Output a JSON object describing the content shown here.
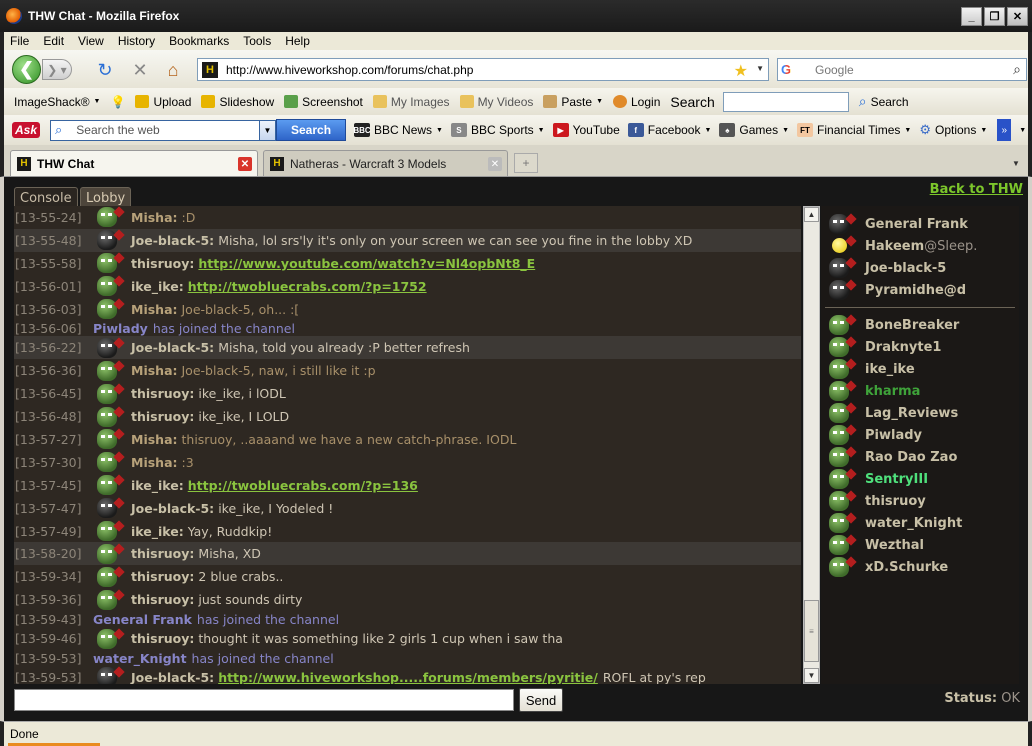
{
  "window": {
    "title": "THW Chat - Mozilla Firefox",
    "min": "_",
    "max": "❐",
    "close": "✕"
  },
  "menu": [
    "File",
    "Edit",
    "View",
    "History",
    "Bookmarks",
    "Tools",
    "Help"
  ],
  "nav": {
    "url": "http://www.hiveworkshop.com/forums/chat.php",
    "search_placeholder": "Google"
  },
  "imageshack": {
    "brand": "ImageShack®",
    "upload": "Upload",
    "slideshow": "Slideshow",
    "screenshot": "Screenshot",
    "my_images": "My Images",
    "my_videos": "My Videos",
    "paste": "Paste",
    "login": "Login",
    "search_label": "Search",
    "search_button": "Search"
  },
  "askbar": {
    "logo": "Ask",
    "placeholder": "Search the web",
    "button": "Search",
    "links": [
      "BBC News",
      "BBC Sports",
      "YouTube",
      "Facebook",
      "Games",
      "Financial Times",
      "Options"
    ]
  },
  "tabs": [
    {
      "label": "THW Chat",
      "active": true
    },
    {
      "label": "Natheras - Warcraft 3 Models",
      "active": false
    }
  ],
  "chat": {
    "back_link": "Back to THW",
    "channel_tabs": [
      "Console",
      "Lobby"
    ],
    "messages": [
      {
        "ts": "[13-55-24]",
        "user": "Misha:",
        "text": ":D",
        "misha": true
      },
      {
        "ts": "[13-55-48]",
        "user": "Joe-black-5:",
        "text": "Misha, lol srs'ly it's only on your screen we can see you fine in the lobby XD",
        "hl": true,
        "dark": true
      },
      {
        "ts": "[13-55-58]",
        "user": "thisruoy:",
        "link": "http://www.youtube.com/watch?v=Nl4opbNt8_E"
      },
      {
        "ts": "[13-56-01]",
        "user": "ike_ike:",
        "link": "http://twobluecrabs.com/?p=1752"
      },
      {
        "ts": "[13-56-03]",
        "user": "Misha:",
        "text": "Joe-black-5, oh... :[",
        "misha": true
      },
      {
        "ts": "[13-56-06]",
        "sys": "Piwlady",
        "systext": "has joined the channel"
      },
      {
        "ts": "[13-56-22]",
        "user": "Joe-black-5:",
        "text": "Misha, told you already :P better refresh",
        "hl": true,
        "dark": true
      },
      {
        "ts": "[13-56-36]",
        "user": "Misha:",
        "text": "Joe-black-5, naw, i still like it :p",
        "misha": true
      },
      {
        "ts": "[13-56-45]",
        "user": "thisruoy:",
        "text": "ike_ike, i lODL"
      },
      {
        "ts": "[13-56-48]",
        "user": "thisruoy:",
        "text": "ike_ike, I LOLD"
      },
      {
        "ts": "[13-57-27]",
        "user": "Misha:",
        "text": "thisruoy, ..aaaand we have a new catch-phrase. IODL",
        "misha": true
      },
      {
        "ts": "[13-57-30]",
        "user": "Misha:",
        "text": ":3",
        "misha": true
      },
      {
        "ts": "[13-57-45]",
        "user": "ike_ike:",
        "link": "http://twobluecrabs.com/?p=136"
      },
      {
        "ts": "[13-57-47]",
        "user": "Joe-black-5:",
        "text": "ike_ike, I Yodeled !",
        "dark": true
      },
      {
        "ts": "[13-57-49]",
        "user": "ike_ike:",
        "text": "Yay, Ruddkip!"
      },
      {
        "ts": "[13-58-20]",
        "user": "thisruoy:",
        "text": "Misha, XD",
        "hl": true
      },
      {
        "ts": "[13-59-34]",
        "user": "thisruoy:",
        "text": "2 blue crabs.."
      },
      {
        "ts": "[13-59-36]",
        "user": "thisruoy:",
        "text": "just sounds dirty"
      },
      {
        "ts": "[13-59-43]",
        "sys": "General Frank",
        "systext": "has joined the channel"
      },
      {
        "ts": "[13-59-46]",
        "user": "thisruoy:",
        "text": "thought it was something like 2 girls 1 cup when i saw tha"
      },
      {
        "ts": "[13-59-53]",
        "sys": "water_Knight",
        "systext": "has joined the channel"
      },
      {
        "ts": "[13-59-53]",
        "user": "Joe-black-5:",
        "link": "http://www.hiveworkshop.....forums/members/pyritie/",
        "text": "ROFL at py's rep",
        "dark": true
      }
    ],
    "users_top": [
      {
        "name": "General Frank",
        "kind": "frank"
      },
      {
        "name": "Hakeem",
        "status": "@Sleep.",
        "kind": "smiley"
      },
      {
        "name": "Joe-black-5",
        "kind": "dark"
      },
      {
        "name": "Pyramidhe@d",
        "kind": "dark"
      }
    ],
    "users": [
      {
        "name": "BoneBreaker"
      },
      {
        "name": "Draknyte1"
      },
      {
        "name": "ike_ike"
      },
      {
        "name": "kharma",
        "color": "green"
      },
      {
        "name": "Lag_Reviews"
      },
      {
        "name": "Piwlady"
      },
      {
        "name": "Rao Dao Zao"
      },
      {
        "name": "SentryIII",
        "color": "cyan"
      },
      {
        "name": "thisruoy"
      },
      {
        "name": "water_Knight"
      },
      {
        "name": "Wezthal"
      },
      {
        "name": "xD.Schurke"
      }
    ],
    "send": "Send",
    "status_label": "Status:",
    "status_value": "OK"
  },
  "statusbar": "Done",
  "colors": {
    "link": "#8ac43f",
    "system": "#8785c8",
    "accent": "#e98b1f"
  }
}
